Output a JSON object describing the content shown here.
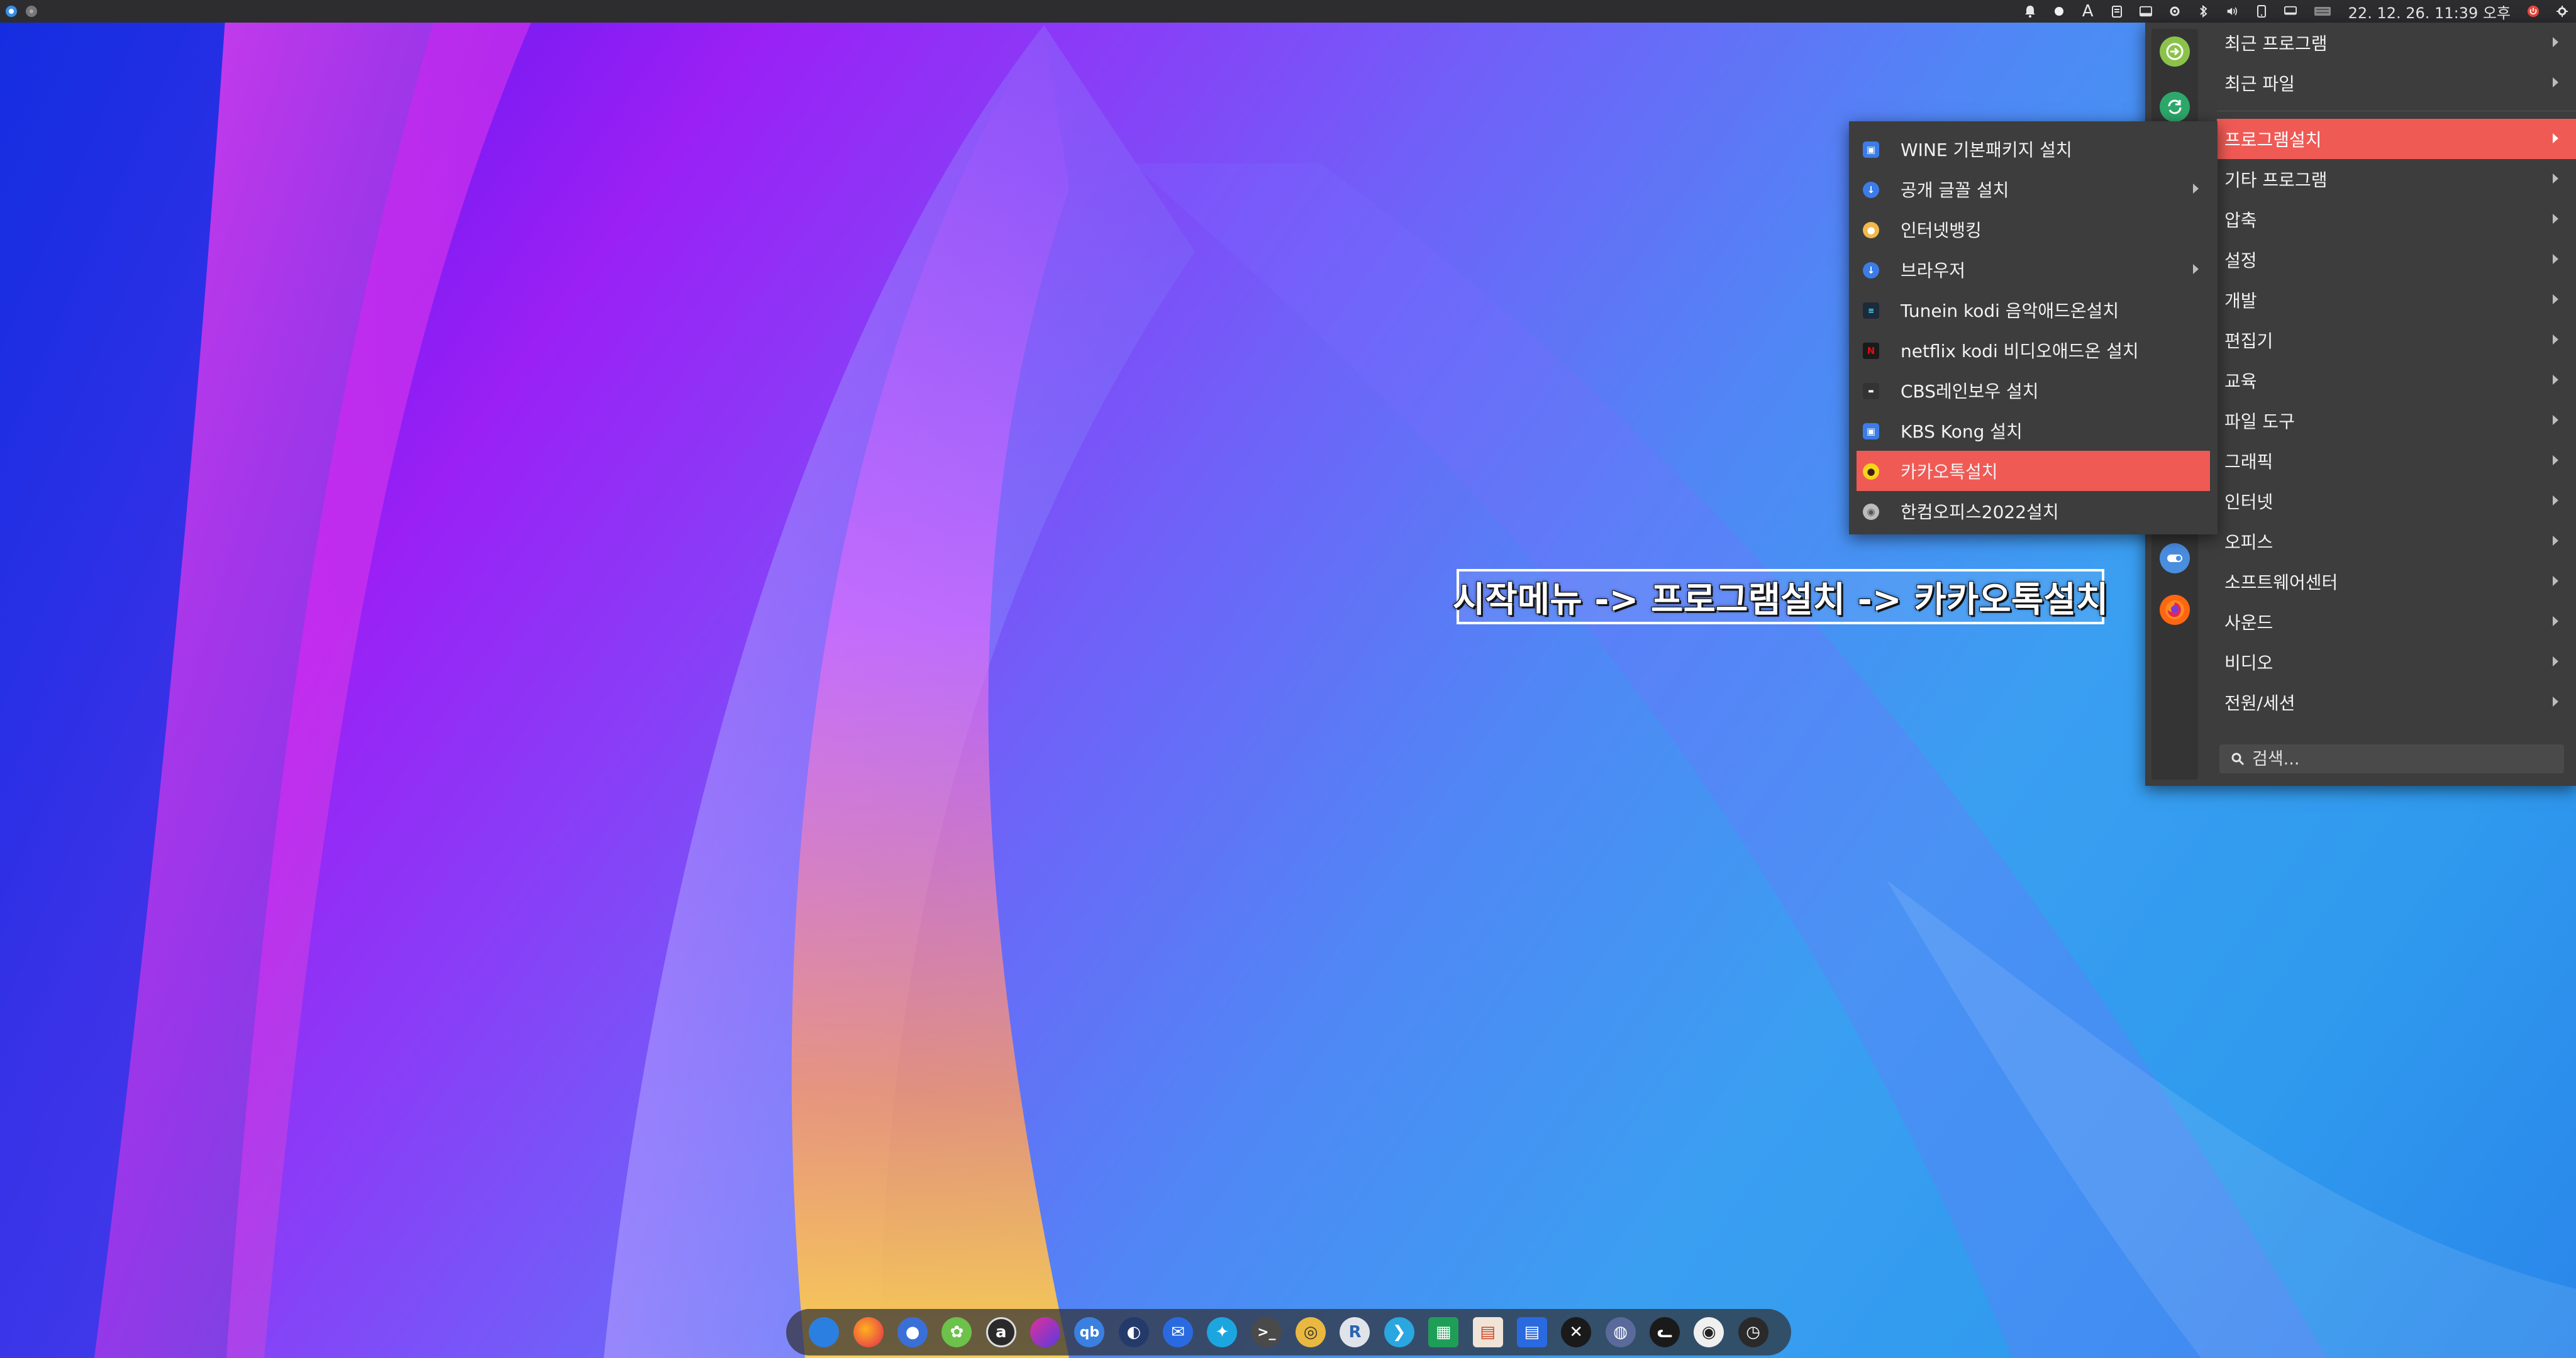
{
  "topbar": {
    "clock": "22. 12. 26. 11:39 오후",
    "tray_icons": [
      "notification-bell-icon",
      "status-dot-icon",
      "keyboard-layout-icon",
      "clipboard-icon",
      "window-icon",
      "settings-icon",
      "bluetooth-icon",
      "volume-icon",
      "phone-icon",
      "display-icon",
      "keyboard-icon"
    ],
    "keyboard_layout_label": "A"
  },
  "main_menu": {
    "items": [
      {
        "label": "최근 프로그램"
      },
      {
        "label": "최근 파일"
      },
      {
        "label": "프로그램설치"
      },
      {
        "label": "기타 프로그램"
      },
      {
        "label": "압축"
      },
      {
        "label": "설정"
      },
      {
        "label": "개발"
      },
      {
        "label": "편집기"
      },
      {
        "label": "교육"
      },
      {
        "label": "파일 도구"
      },
      {
        "label": "그래픽"
      },
      {
        "label": "인터넷"
      },
      {
        "label": "오피스"
      },
      {
        "label": "소프트웨어센터"
      },
      {
        "label": "사운드"
      },
      {
        "label": "비디오"
      },
      {
        "label": "전원/세션"
      }
    ],
    "search_placeholder": "검색..."
  },
  "sub_menu": {
    "items": [
      {
        "label": "WINE 기본패키지 설치",
        "icon": "wine-icon",
        "color": "#3b7ce8"
      },
      {
        "label": "공개 글꼴 설치",
        "icon": "font-install-icon",
        "color": "#3b7ce8"
      },
      {
        "label": "인터넷뱅킹",
        "icon": "banking-icon",
        "color": "#f2b84b"
      },
      {
        "label": "브라우저",
        "icon": "browser-install-icon",
        "color": "#3b7ce8"
      },
      {
        "label": "Tunein kodi 음악애드온설치",
        "icon": "tunein-icon",
        "color": "#1c2a3a"
      },
      {
        "label": "netflix kodi 비디오애드온 설치",
        "icon": "netflix-icon",
        "color": "#1a1a1a"
      },
      {
        "label": "CBS레인보우 설치",
        "icon": "cbs-icon",
        "color": "#333333"
      },
      {
        "label": "KBS Kong 설치",
        "icon": "kbs-kong-icon",
        "color": "#3b7ce8"
      },
      {
        "label": "카카오톡설치",
        "icon": "kakaotalk-icon",
        "color": "#f7d417"
      },
      {
        "label": "한컴오피스2022설치",
        "icon": "hancom-office-icon",
        "color": "#bcbcbc"
      }
    ]
  },
  "caption": "시작메뉴 -> 프로그램설치 -> 카카오톡설치",
  "accent_color": "#f05a55"
}
